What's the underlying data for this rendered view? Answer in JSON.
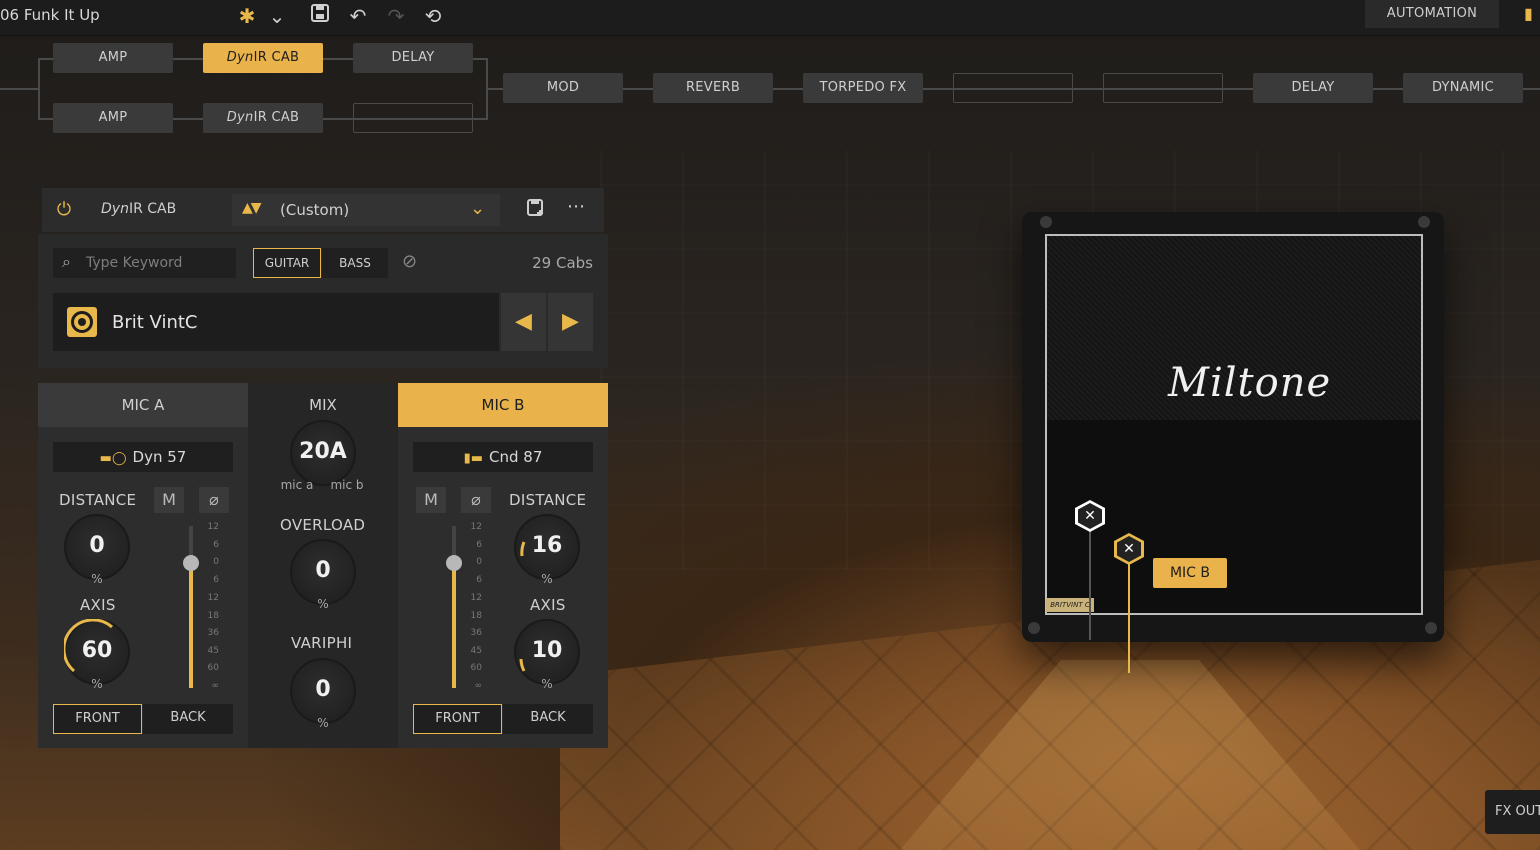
{
  "preset": {
    "title": "06 Funk It Up"
  },
  "toolbar": {
    "icons": [
      "star-icon",
      "chevron-down-icon",
      "save-icon",
      "undo-icon",
      "redo-icon",
      "history-icon"
    ],
    "automation_label": "AUTOMATION"
  },
  "chain": {
    "row1": [
      {
        "label_italic": "",
        "label": "AMP"
      },
      {
        "label_italic": "Dyn",
        "label": "IR CAB",
        "active": true
      },
      {
        "label_italic": "",
        "label": "DELAY"
      }
    ],
    "row2": [
      {
        "label_italic": "",
        "label": "AMP"
      },
      {
        "label_italic": "Dyn",
        "label": "IR CAB"
      },
      {
        "label_italic": "",
        "label": ""
      }
    ],
    "main": [
      "MOD",
      "REVERB",
      "TORPEDO FX",
      "",
      "",
      "DELAY",
      "DYNAMIC"
    ]
  },
  "cab_panel": {
    "module_name_italic": "Dyn",
    "module_name": "IR CAB",
    "preset_name": "(Custom)",
    "search_placeholder": "Type Keyword",
    "guitar_label": "GUITAR",
    "bass_label": "BASS",
    "cab_count": "29 Cabs",
    "selected_cab": "Brit VintC"
  },
  "mic_a": {
    "header": "MIC A",
    "model": "Dyn 57",
    "distance_label": "DISTANCE",
    "distance_value": "0",
    "axis_label": "AXIS",
    "axis_value": "60",
    "unit": "%",
    "mute_label": "M",
    "front_label": "FRONT",
    "back_label": "BACK"
  },
  "mix": {
    "label": "MIX",
    "value": "20A",
    "mic_a_label": "mic a",
    "mic_b_label": "mic b",
    "overload_label": "OVERLOAD",
    "overload_value": "0",
    "variphi_label": "VARIPHI",
    "variphi_value": "0",
    "unit": "%"
  },
  "mic_b": {
    "header": "MIC B",
    "model": "Cnd 87",
    "distance_label": "DISTANCE",
    "distance_value": "16",
    "axis_label": "AXIS",
    "axis_value": "10",
    "unit": "%",
    "mute_label": "M",
    "front_label": "FRONT",
    "back_label": "BACK"
  },
  "fader_scale": [
    "12",
    "6",
    "0",
    "6",
    "12",
    "18",
    "36",
    "45",
    "60",
    "∞"
  ],
  "cabinet": {
    "brand": "Miltone",
    "badge": "BRITVINT C",
    "mic_b_tag": "MIC B"
  },
  "footer": {
    "fx_out_label": "FX OUT"
  },
  "colors": {
    "accent": "#e9b24a",
    "panel": "#2d2d2d",
    "dark": "#1d1d1d"
  }
}
